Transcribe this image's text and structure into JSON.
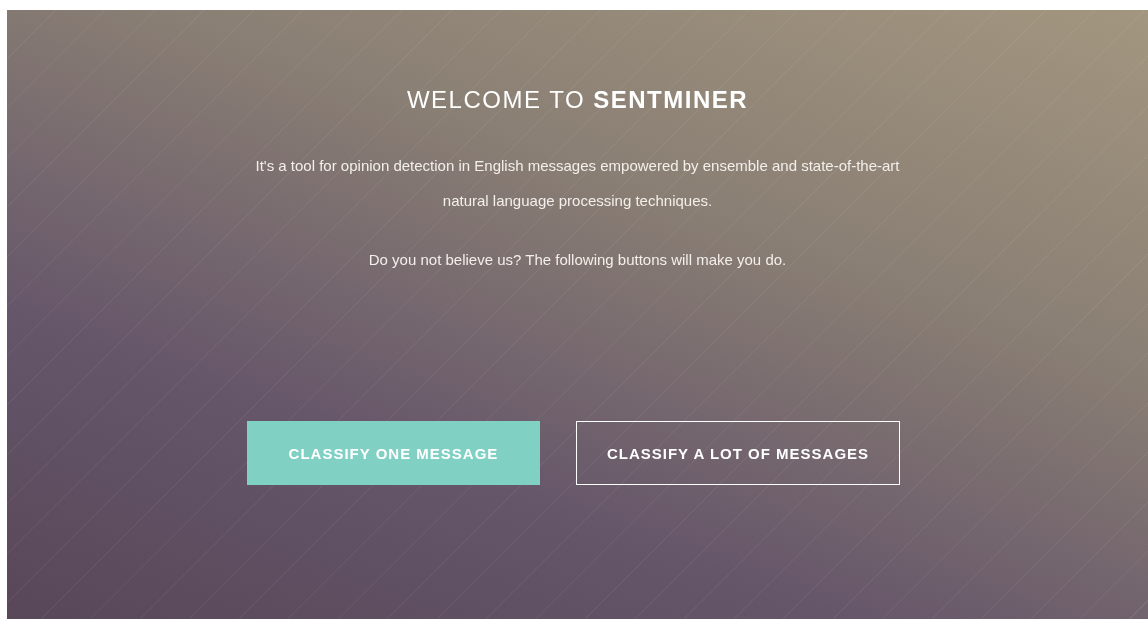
{
  "hero": {
    "title": "WELCOME TO **SENTMINER**",
    "paragraphs": [
      "It's a tool for opinion detection in English messages empowered by ensemble and state-of-the-art natural language processing techniques.",
      "Do you not believe us? The following buttons will make you do."
    ],
    "buttons": [
      {
        "label": "CLASSIFY ONE MESSAGE",
        "kind": "filled"
      },
      {
        "label": "CLASSIFY A LOT OF MESSAGES",
        "kind": "outline"
      }
    ]
  }
}
